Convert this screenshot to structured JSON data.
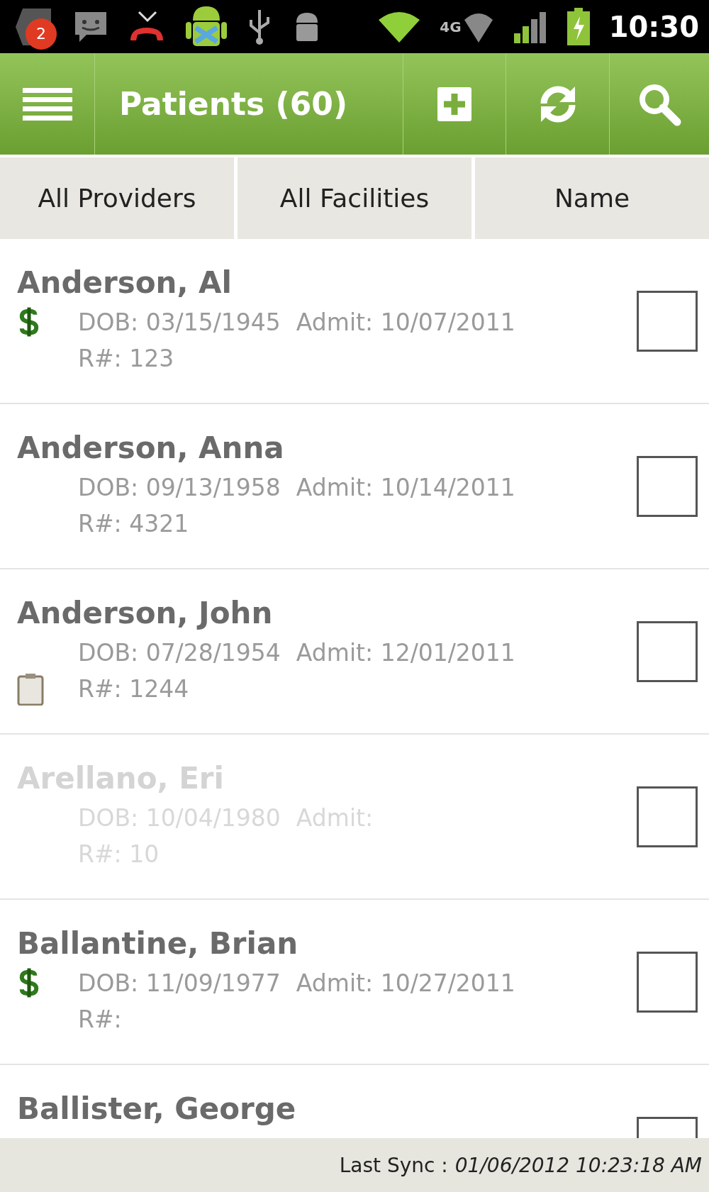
{
  "status_bar": {
    "notification_count": "2",
    "network_label": "4G",
    "time": "10:30"
  },
  "header": {
    "title": "Patients (60)"
  },
  "filters": [
    {
      "label": "All Providers"
    },
    {
      "label": "All Facilities"
    },
    {
      "label": "Name"
    }
  ],
  "patients": [
    {
      "name": "Anderson, Al",
      "kind": "dollar",
      "dob": "DOB: 03/15/1945",
      "admit": "Admit: 10/07/2011",
      "rnum": "R#: 123",
      "inactive": false,
      "checked": false
    },
    {
      "name": "Anderson, Anna",
      "dob": "DOB: 09/13/1958",
      "admit": "Admit: 10/14/2011",
      "rnum": "R#: 4321",
      "inactive": false,
      "checked": false
    },
    {
      "name": "Anderson, John",
      "kind": "clipboard",
      "dob": "DOB: 07/28/1954",
      "admit": "Admit: 12/01/2011",
      "rnum": "R#: 1244",
      "inactive": false,
      "checked": false
    },
    {
      "name": "Arellano, Eri",
      "dob": "DOB: 10/04/1980",
      "admit": "Admit:",
      "rnum": "R#: 10",
      "inactive": true,
      "checked": false
    },
    {
      "name": "Ballantine, Brian",
      "kind": "dollar",
      "dob": "DOB: 11/09/1977",
      "admit": "Admit: 10/27/2011",
      "rnum": "R#:",
      "inactive": false,
      "checked": false
    },
    {
      "name": "Ballister, George",
      "inactive": false,
      "checked": false
    }
  ],
  "footer": {
    "label": "Last Sync :",
    "value": "01/06/2012 10:23:18 AM"
  }
}
